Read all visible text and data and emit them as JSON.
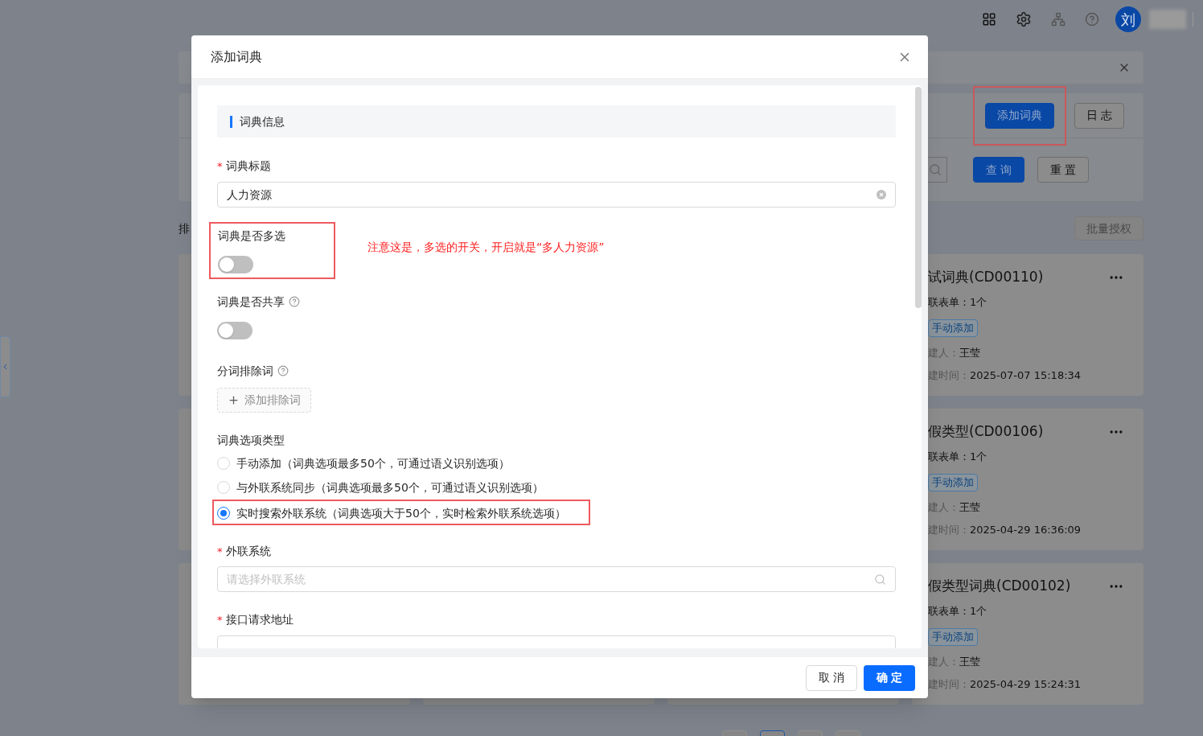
{
  "topbar": {
    "avatar": "刘"
  },
  "toolbar": {
    "buttons": [
      {
        "label": "添加词典",
        "kind": "primary",
        "highlighted": true
      },
      {
        "label": "日 志",
        "kind": "default",
        "highlighted": false
      }
    ]
  },
  "search_row": {
    "buttons": [
      {
        "label": "查 询",
        "kind": "primary"
      },
      {
        "label": "重 置",
        "kind": "default"
      }
    ]
  },
  "list_heading": "排",
  "batch_button": {
    "label": "批量授权",
    "disabled": true
  },
  "cards": [
    {
      "title": "试词典(CD00110)",
      "forms": "联表单：1个",
      "tag": "手动添加",
      "creator_label": "建人：",
      "creator": "王莹",
      "time_label": "建时间：",
      "time": "2025-07-07 15:18:34"
    },
    {
      "title": "假类型(CD00106)",
      "forms": "联表单：1个",
      "tag": "手动添加",
      "creator_label": "建人：",
      "creator": "王莹",
      "time_label": "建时间：",
      "time": "2025-04-29 16:36:09"
    },
    {
      "title": "假类型词典(CD00102)",
      "forms": "联表单：1个",
      "tag": "手动添加",
      "creator_label": "建人：",
      "creator": "王莹",
      "time_label": "建时间：",
      "time": "2025-04-29 15:24:31"
    }
  ],
  "dialog": {
    "title": "添加词典",
    "section_title": "词典信息",
    "fields": [
      {
        "kind": "text",
        "label": "词典标题",
        "required_mark": "*",
        "value": "人力资源"
      },
      {
        "kind": "switch",
        "label": "词典是否多选",
        "on": false,
        "highlighted": true,
        "note": "注意这是，多选的开关，开启就是“多人力资源”"
      },
      {
        "kind": "switch",
        "label": "词典是否共享",
        "on": false,
        "help": true,
        "highlighted": false
      },
      {
        "kind": "tags",
        "label": "分词排除词",
        "help": true,
        "button_label": "添加排除词"
      },
      {
        "kind": "radio",
        "label": "词典选项类型",
        "options": [
          {
            "label": "手动添加（词典选项最多50个，可通过语义识别选项）",
            "selected": false,
            "highlighted": false
          },
          {
            "label": "与外联系统同步（词典选项最多50个，可通过语义识别选项）",
            "selected": false,
            "highlighted": false
          },
          {
            "label": "实时搜索外联系统（词典选项大于50个，实时检索外联系统选项）",
            "selected": true,
            "highlighted": true
          }
        ]
      },
      {
        "kind": "search",
        "label": "外联系统",
        "required_mark": "*",
        "placeholder": "请选择外联系统"
      },
      {
        "kind": "text",
        "label": "接口请求地址",
        "required_mark": "*"
      }
    ],
    "buttons": [
      {
        "label": "取 消",
        "kind": "default"
      },
      {
        "label": "确 定",
        "kind": "primary"
      }
    ]
  }
}
